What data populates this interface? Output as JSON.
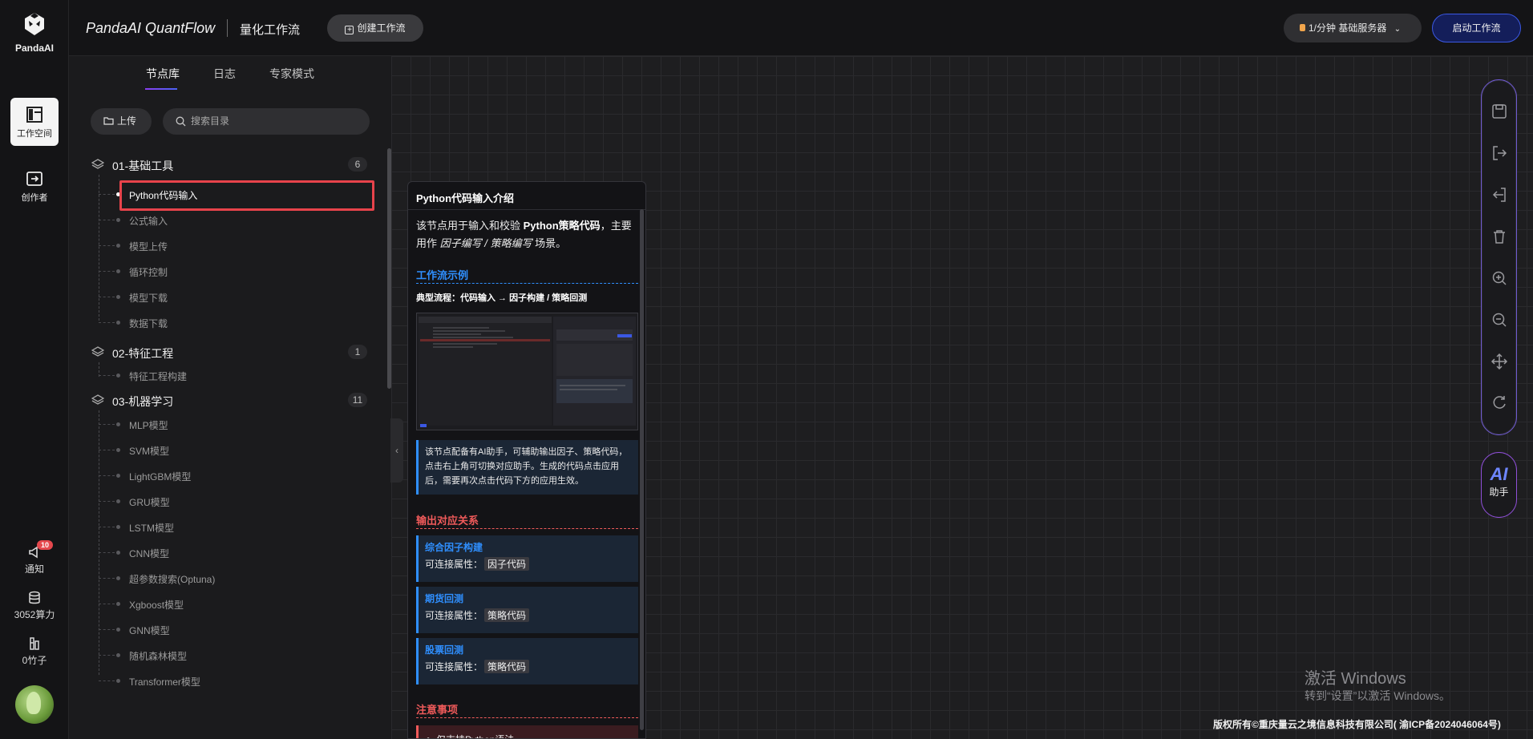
{
  "brand": {
    "logo_text": "PandaAI",
    "app_name": "PandaAI QuantFlow",
    "subtitle": "量化工作流"
  },
  "header": {
    "create_label": "创建工作流",
    "server_label": "1/分钟  基础服务器",
    "launch_label": "启动工作流"
  },
  "rail": {
    "workspace": "工作空间",
    "creator": "创作者",
    "notify": "通知",
    "notify_badge": "10",
    "compute": "3052算力",
    "bamboo": "0竹子"
  },
  "panel": {
    "tabs": [
      "节点库",
      "日志",
      "专家模式"
    ],
    "upload_label": "上传",
    "search_placeholder": "搜索目录"
  },
  "categories": [
    {
      "name": "01-基础工具",
      "count": "6",
      "items": [
        "Python代码输入",
        "公式输入",
        "模型上传",
        "循环控制",
        "模型下载",
        "数据下载"
      ]
    },
    {
      "name": "02-特征工程",
      "count": "1",
      "items": [
        "特征工程构建"
      ]
    },
    {
      "name": "03-机器学习",
      "count": "11",
      "items": [
        "MLP模型",
        "SVM模型",
        "LightGBM模型",
        "GRU模型",
        "LSTM模型",
        "CNN模型",
        "超参数搜索(Optuna)",
        "Xgboost模型",
        "GNN模型",
        "随机森林模型",
        "Transformer模型"
      ]
    }
  ],
  "popup": {
    "title": "Python代码输入介绍",
    "desc_pre": "该节点用于输入和校验 ",
    "desc_bold": "Python策略代码",
    "desc_mid": "，主要用作 ",
    "desc_italic": "因子编写 / 策略编写",
    "desc_post": " 场景。",
    "sec_example": "工作流示例",
    "flow": "典型流程：代码输入 → 因子构建 / 策略回测",
    "tip": "该节点配备有AI助手，可辅助输出因子、策略代码，点击右上角可切换对应助手。生成的代码点击应用后，需要再次点击代码下方的应用生效。",
    "sec_output": "输出对应关系",
    "attr_label": "可连接属性：",
    "outputs": [
      {
        "title": "综合因子构建",
        "tag": "因子代码"
      },
      {
        "title": "期货回测",
        "tag": "策略代码"
      },
      {
        "title": "股票回测",
        "tag": "策略代码"
      }
    ],
    "sec_notes": "注意事项",
    "note_first": "仅支持Python语法"
  },
  "assistant": {
    "ai": "AI",
    "label": "助手"
  },
  "watermark": {
    "line1": "激活 Windows",
    "line2": "转到“设置”以激活 Windows。"
  },
  "footer": {
    "copyright": "版权所有©重庆量云之境信息科技有限公司( 渝ICP备2024046064号)"
  },
  "colors": {
    "accent_blue": "#2f8fff",
    "accent_red": "#ef5a5a",
    "launch_border": "#3b58e3",
    "selection": "#e8434b"
  }
}
